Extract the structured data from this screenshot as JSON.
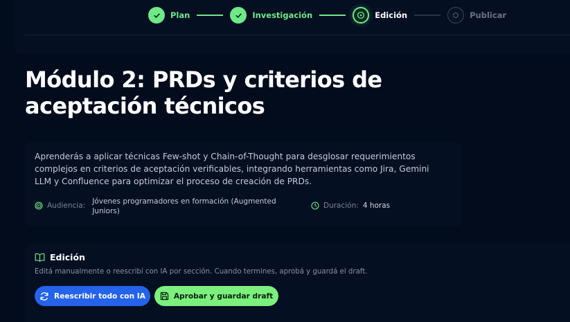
{
  "stepper": {
    "steps": [
      {
        "label": "Plan",
        "state": "done"
      },
      {
        "label": "Investigación",
        "state": "done"
      },
      {
        "label": "Edición",
        "state": "active"
      },
      {
        "label": "Publicar",
        "state": "pending"
      }
    ]
  },
  "module": {
    "title": "Módulo 2: PRDs y criterios de aceptación técnicos",
    "description": "Aprenderás a aplicar técnicas Few-shot y Chain-of-Thought para desglosar requerimientos complejos en criterios de aceptación verificables, integrando herramientas como Jira, Gemini LLM y Confluence para optimizar el proceso de creación de PRDs.",
    "audience_label": "Audiencia:",
    "audience_value": "Jóvenes programadores en formación (Augmented Juniors)",
    "duration_label": "Duración:",
    "duration_value": "4 horas"
  },
  "edition": {
    "title": "Edición",
    "subtitle": "Editá manualmente o reescribí con IA por sección. Cuando termines, aprobá y guardá el draft.",
    "rewrite_all_label": "Reescribir todo con IA",
    "approve_save_label": "Aprobar y guardar draft"
  },
  "icons": {
    "check": "check-icon",
    "target": "target-icon",
    "clock": "clock-icon",
    "book": "book-open-icon",
    "refresh": "refresh-icon",
    "save": "save-icon"
  },
  "colors": {
    "background": "#030c1d",
    "accent_green": "#6ee987",
    "primary_blue": "#2563eb",
    "approve_green": "#7cf07c"
  }
}
